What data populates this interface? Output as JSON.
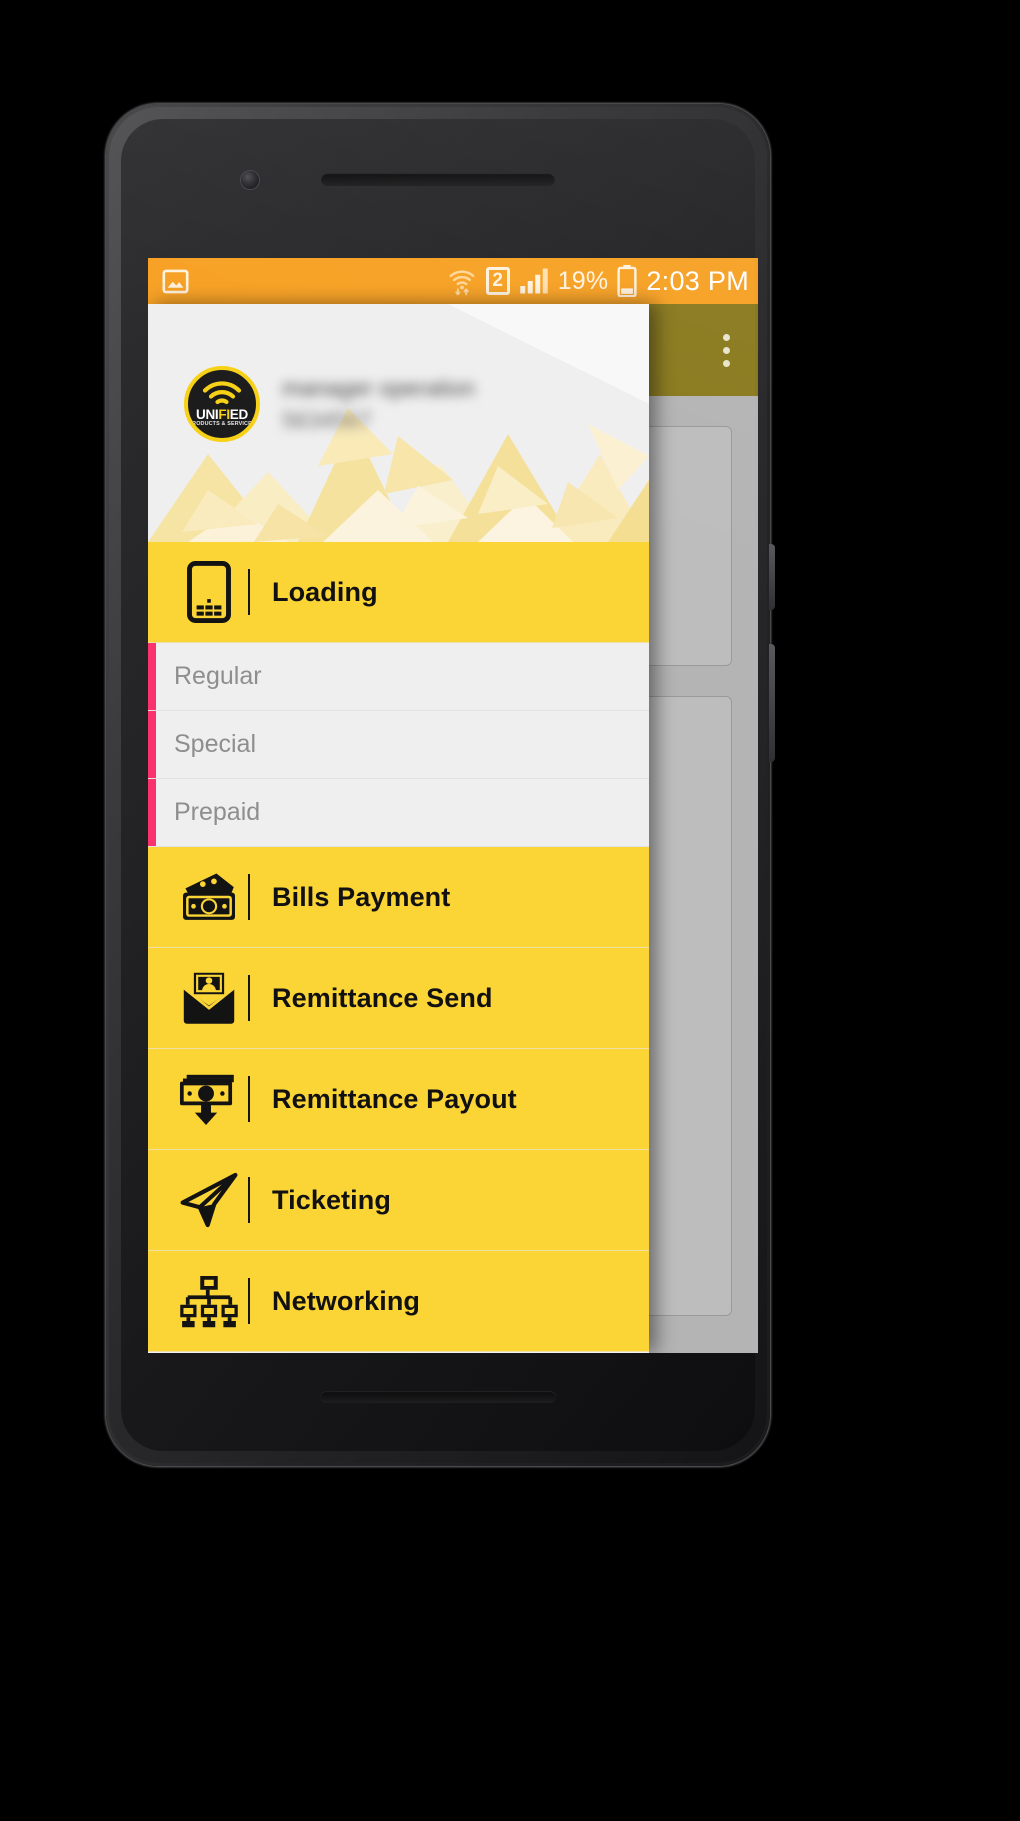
{
  "device": {
    "type": "android-phone-mockup",
    "orientation": "portrait"
  },
  "status_bar": {
    "background_color": "#F7A124",
    "notification_icon": "photo-icon",
    "wifi_icon": "wifi-transfer-icon",
    "sim_label": "2",
    "signal_icon": "signal-bars-icon",
    "battery_percent": "19%",
    "battery_icon": "battery-low-icon",
    "clock": "2:03 PM"
  },
  "app_behind": {
    "app_bar_color": "#8A7A1E",
    "overflow_menu_icon": "kebab-menu-icon",
    "scrim_color": "#B3B3B3"
  },
  "drawer": {
    "header": {
      "logo_brand_un": "UNI",
      "logo_brand_fi": "FI",
      "logo_brand_ed": "ED",
      "logo_tagline": "PRODUCTS & SERVICES",
      "logo_wifi_icon": "wifi-icon",
      "account_name": "manager operation",
      "account_number": "5634567",
      "name_blurred": true
    },
    "accent_colors": {
      "item_yellow": "#FBD436",
      "subitem_gray": "#EFEFEF",
      "subitem_accent_pink": "#F8336E",
      "text_dark": "#111111",
      "subtext_gray": "#8E8E8E"
    },
    "items": [
      {
        "label": "Loading",
        "icon": "mobile-phone-icon",
        "type": "parent"
      },
      {
        "label": "Regular",
        "icon": null,
        "type": "sub"
      },
      {
        "label": "Special",
        "icon": null,
        "type": "sub"
      },
      {
        "label": "Prepaid",
        "icon": null,
        "type": "sub"
      },
      {
        "label": "Bills Payment",
        "icon": "money-cash-icon",
        "type": "parent"
      },
      {
        "label": "Remittance Send",
        "icon": "envelope-money-icon",
        "type": "parent"
      },
      {
        "label": "Remittance Payout",
        "icon": "money-down-arrow-icon",
        "type": "parent"
      },
      {
        "label": "Ticketing",
        "icon": "paper-plane-icon",
        "type": "parent"
      },
      {
        "label": "Networking",
        "icon": "org-chart-icon",
        "type": "parent"
      }
    ]
  }
}
